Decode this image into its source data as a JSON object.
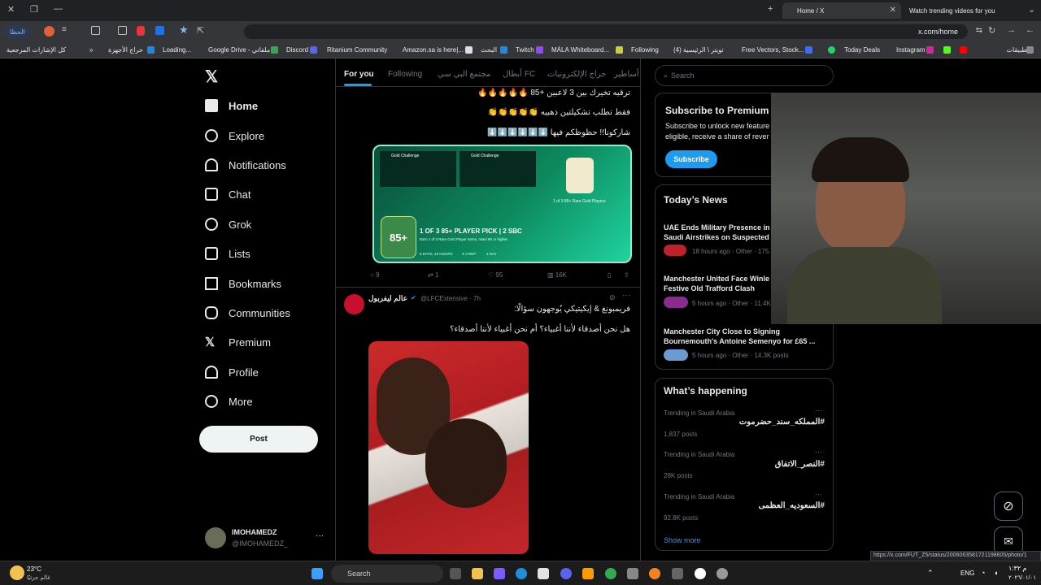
{
  "browser": {
    "tabs": [
      {
        "label": "Home / X"
      },
      {
        "label": "Watch trending videos for you"
      }
    ],
    "url": "x.com/home",
    "left_button": "الحظا",
    "bookmarks": [
      "التطبيقات",
      "Instagram",
      "Today Deals",
      "Free Vectors, Stock...",
      "(4) تويتر \\ الرئيسية",
      "Following",
      "MÁLA Whiteboard...",
      "Twitch",
      "البحث",
      "Amazon.sa is here|...",
      "Ritanium Community",
      "Discord",
      "Google Drive - ملفاتي",
      "Loading...",
      "حراج الأجهزة",
      "كل الإشارات المرجعية"
    ]
  },
  "sidebar": {
    "items": [
      {
        "label": "Home"
      },
      {
        "label": "Explore"
      },
      {
        "label": "Notifications"
      },
      {
        "label": "Chat"
      },
      {
        "label": "Grok"
      },
      {
        "label": "Lists"
      },
      {
        "label": "Bookmarks"
      },
      {
        "label": "Communities"
      },
      {
        "label": "Premium"
      },
      {
        "label": "Profile"
      },
      {
        "label": "More"
      }
    ],
    "post_label": "Post",
    "account": {
      "name": "IMOHAMEDZ",
      "handle": "@IMOHAMEDZ_"
    }
  },
  "feed": {
    "tabs": [
      "For you",
      "Following",
      "مجتمع البي سي",
      "أبطال FC",
      "حراج الإلكترونيات",
      "أساطير"
    ],
    "post1": {
      "lines": [
        "ترقيه تخيرك بين 3 لاعبين +85 🔥🔥🔥🔥🔥",
        "فقط تطلب تشكيلتين ذهبيه 👏👏👏👏👏",
        "شاركونا!! حظوظكم فيها ⬇️⬇️⬇️⬇️⬇️⬇️"
      ],
      "card": {
        "challenge1": "Gold Challenge",
        "challenge2": "Gold Challenge",
        "pick_title": "1 OF 3 85+ PLAYER PICK | 2 SBC",
        "pick_sub": "Earn 1 of 3 Rare Gold Player Items, rated 85 or higher.",
        "badge": "85+",
        "rare": "1 of 3 85+ Rare Gold Players",
        "meta1": "6 DAYS, 23 HOURS",
        "meta2": "X 3 REP",
        "meta3": "1 DAY"
      },
      "stats": {
        "replies": "9",
        "reposts": "1",
        "likes": "95",
        "views": "16K"
      }
    },
    "post2": {
      "name": "عالم ليفربول",
      "handle": "@LFCExtensive · 7h",
      "line1": "فريمبونغ & إيكيتيكي يُوجهون سؤالًا:",
      "line2": "هل نحن أصدقاء لأننا أغبياء؟ أم نحن أغبياء لأننا أصدقاء؟"
    }
  },
  "right": {
    "search_placeholder": "Search",
    "premium": {
      "title": "Subscribe to Premium",
      "text1": "Subscribe to unlock new feature",
      "text2": "eligible, receive a share of rever",
      "button": "Subscribe"
    },
    "news": {
      "title": "Today’s News",
      "items": [
        {
          "title1": "UAE Ends Military Presence in",
          "title2": "Saudi Airstrikes on Suspected",
          "meta": "18 hours ago · Other · 175.7"
        },
        {
          "title1": "Manchester United Face Winle",
          "title2": "Festive Old Trafford Clash",
          "meta": "5 hours ago · Other · 11.4K"
        },
        {
          "title1": "Manchester City Close to Signing",
          "title2": "Bournemouth's Antoine Semenyo for £65 ...",
          "meta": "5 hours ago · Other · 14.3K posts"
        }
      ]
    },
    "happening": {
      "title": "What’s happening",
      "items": [
        {
          "meta": "Trending in Saudi Arabia",
          "tag": "#المملكه_سند_حضرموت",
          "posts": "1,837 posts"
        },
        {
          "meta": "Trending in Saudi Arabia",
          "tag": "#النصر_الاتفاق",
          "posts": "28K posts"
        },
        {
          "meta": "Trending in Saudi Arabia",
          "tag": "#السعوديه_العظمى",
          "posts": "92.8K posts"
        }
      ],
      "show_more": "Show more"
    }
  },
  "status_url": "https://x.com/FUT_Z5/status/2006063581721198605/photo/1",
  "taskbar": {
    "weather_temp": "23°C",
    "weather_label": "غالم جزئيًا",
    "search": "Search",
    "lang": "ENG",
    "time": "م ١:٣٢",
    "date": "٢٠٢٦/٠١/٠١"
  }
}
